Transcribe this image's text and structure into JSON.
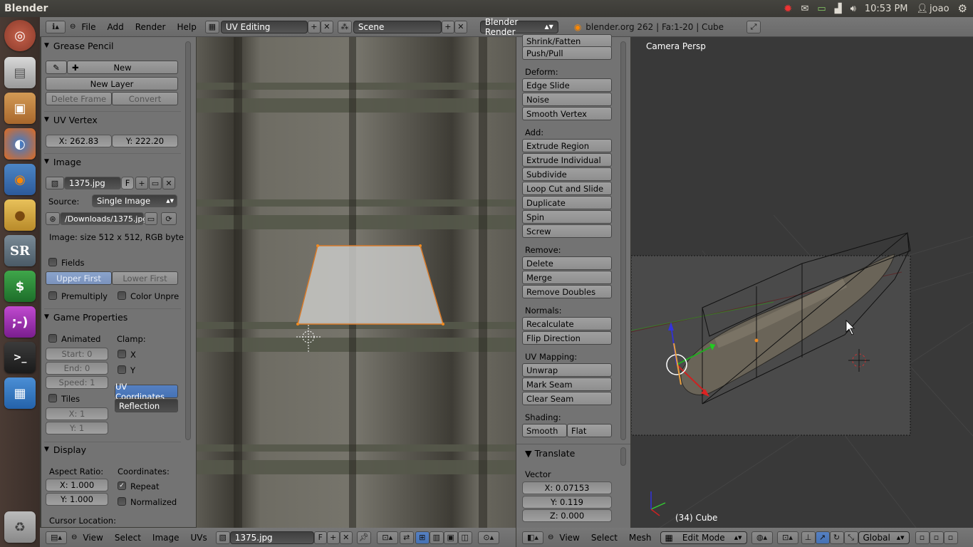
{
  "os": {
    "app_title": "Blender",
    "clock": "10:53 PM",
    "user": "joao",
    "launcher_items": [
      "ubuntu-dash",
      "files",
      "archive",
      "firefox",
      "blender",
      "cookie",
      "sr",
      "money",
      "chat",
      "terminal",
      "workspace",
      "trash"
    ]
  },
  "header": {
    "menus": [
      "File",
      "Add",
      "Render",
      "Help"
    ],
    "layout": "UV Editing",
    "scene": "Scene",
    "engine": "Blender Render",
    "stats": "blender.org 262 | Fa:1-20 | Cube"
  },
  "left_panel": {
    "grease_pencil": {
      "title": "Grease Pencil",
      "new": "New",
      "new_layer": "New Layer",
      "delete_frame": "Delete Frame",
      "convert": "Convert"
    },
    "uv_vertex": {
      "title": "UV Vertex",
      "x": "X: 262.83",
      "y": "Y: 222.20"
    },
    "image": {
      "title": "Image",
      "name": "1375.jpg",
      "f": "F",
      "source_label": "Source:",
      "source": "Single Image",
      "path": "/Downloads/1375.jpg",
      "info": "Image: size 512 x 512, RGB byte",
      "fields": "Fields",
      "upper_first": "Upper First",
      "lower_first": "Lower First",
      "premultiply": "Premultiply",
      "color_unpre": "Color Unpre"
    },
    "game_properties": {
      "title": "Game Properties",
      "animated": "Animated",
      "clamp": "Clamp:",
      "start": "Start: 0",
      "end": "End: 0",
      "speed": "Speed: 1",
      "x": "X",
      "y": "Y",
      "tiles": "Tiles",
      "tx": "X: 1",
      "ty": "Y: 1",
      "uv_coordinates": "UV Coordinates",
      "reflection": "Reflection"
    },
    "display": {
      "title": "Display",
      "aspect": "Aspect Ratio:",
      "coords": "Coordinates:",
      "ax": "X: 1.000",
      "ay": "Y: 1.000",
      "repeat": "Repeat",
      "normalized": "Normalized",
      "cursor": "Cursor Location:"
    }
  },
  "tools": {
    "top": [
      "Shrink/Fatten",
      "Push/Pull"
    ],
    "deform_label": "Deform:",
    "deform": [
      "Edge Slide",
      "Noise",
      "Smooth Vertex"
    ],
    "add_label": "Add:",
    "add": [
      "Extrude Region",
      "Extrude Individual",
      "Subdivide",
      "Loop Cut and Slide",
      "Duplicate",
      "Spin",
      "Screw"
    ],
    "remove_label": "Remove:",
    "remove": [
      "Delete",
      "Merge",
      "Remove Doubles"
    ],
    "normals_label": "Normals:",
    "normals": [
      "Recalculate",
      "Flip Direction"
    ],
    "uv_label": "UV Mapping:",
    "uv": [
      "Unwrap",
      "Mark Seam",
      "Clear Seam"
    ],
    "shading_label": "Shading:",
    "smooth": "Smooth",
    "flat": "Flat",
    "translate": {
      "title": "Translate",
      "vector": "Vector",
      "x": "X: 0.07153",
      "y": "Y: 0.119",
      "z": "Z: 0.000"
    }
  },
  "viewport": {
    "label": "Camera Persp",
    "object": "(34) Cube"
  },
  "uv_footer": {
    "menus": [
      "View",
      "Select",
      "Image",
      "UVs"
    ],
    "image": "1375.jpg",
    "f": "F"
  },
  "view3d_footer": {
    "menus": [
      "View",
      "Select",
      "Mesh"
    ],
    "mode": "Edit Mode",
    "orientation": "Global"
  }
}
